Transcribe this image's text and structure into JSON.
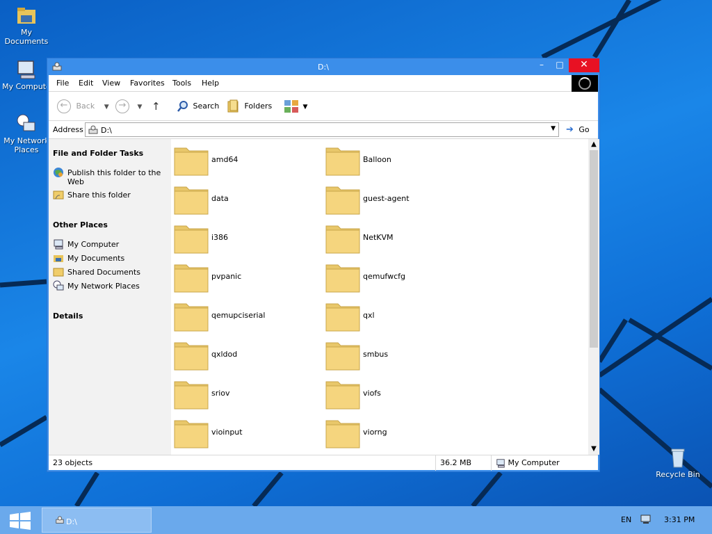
{
  "desktop": {
    "icons": [
      {
        "label": "My Documents",
        "icon": "my-documents-icon"
      },
      {
        "label": "My Compute",
        "icon": "my-computer-icon"
      },
      {
        "label": "My Network Places",
        "icon": "network-places-icon"
      },
      {
        "label": "Recycle Bin",
        "icon": "recycle-bin-icon"
      }
    ]
  },
  "window": {
    "title": "D:\\",
    "menu": [
      "File",
      "Edit",
      "View",
      "Favorites",
      "Tools",
      "Help"
    ],
    "toolbar": {
      "back": "Back",
      "search": "Search",
      "folders": "Folders"
    },
    "address": {
      "label": "Address",
      "value": "D:\\",
      "go": "Go"
    },
    "sidebar": {
      "tasks_heading": "File and Folder Tasks",
      "tasks": [
        "Publish this folder to the Web",
        "Share this folder"
      ],
      "places_heading": "Other Places",
      "places": [
        "My Computer",
        "My Documents",
        "Shared Documents",
        "My Network Places"
      ],
      "details_heading": "Details"
    },
    "folders": [
      "amd64",
      "Balloon",
      "data",
      "guest-agent",
      "i386",
      "NetKVM",
      "pvpanic",
      "qemufwcfg",
      "qemupciserial",
      "qxl",
      "qxldod",
      "smbus",
      "sriov",
      "viofs",
      "vioinput",
      "viorng"
    ],
    "status": {
      "objects": "23 objects",
      "size": "36.2 MB",
      "zone": "My Computer"
    }
  },
  "taskbar": {
    "task_label": "D:\\",
    "lang": "EN",
    "time": "3:31 PM"
  },
  "colors": {
    "desktop": "#1a86e8",
    "title_bar": "#3b8eea",
    "close_button": "#e81123",
    "folder": "#f5d57e",
    "taskbar": "#6aa9ec"
  }
}
